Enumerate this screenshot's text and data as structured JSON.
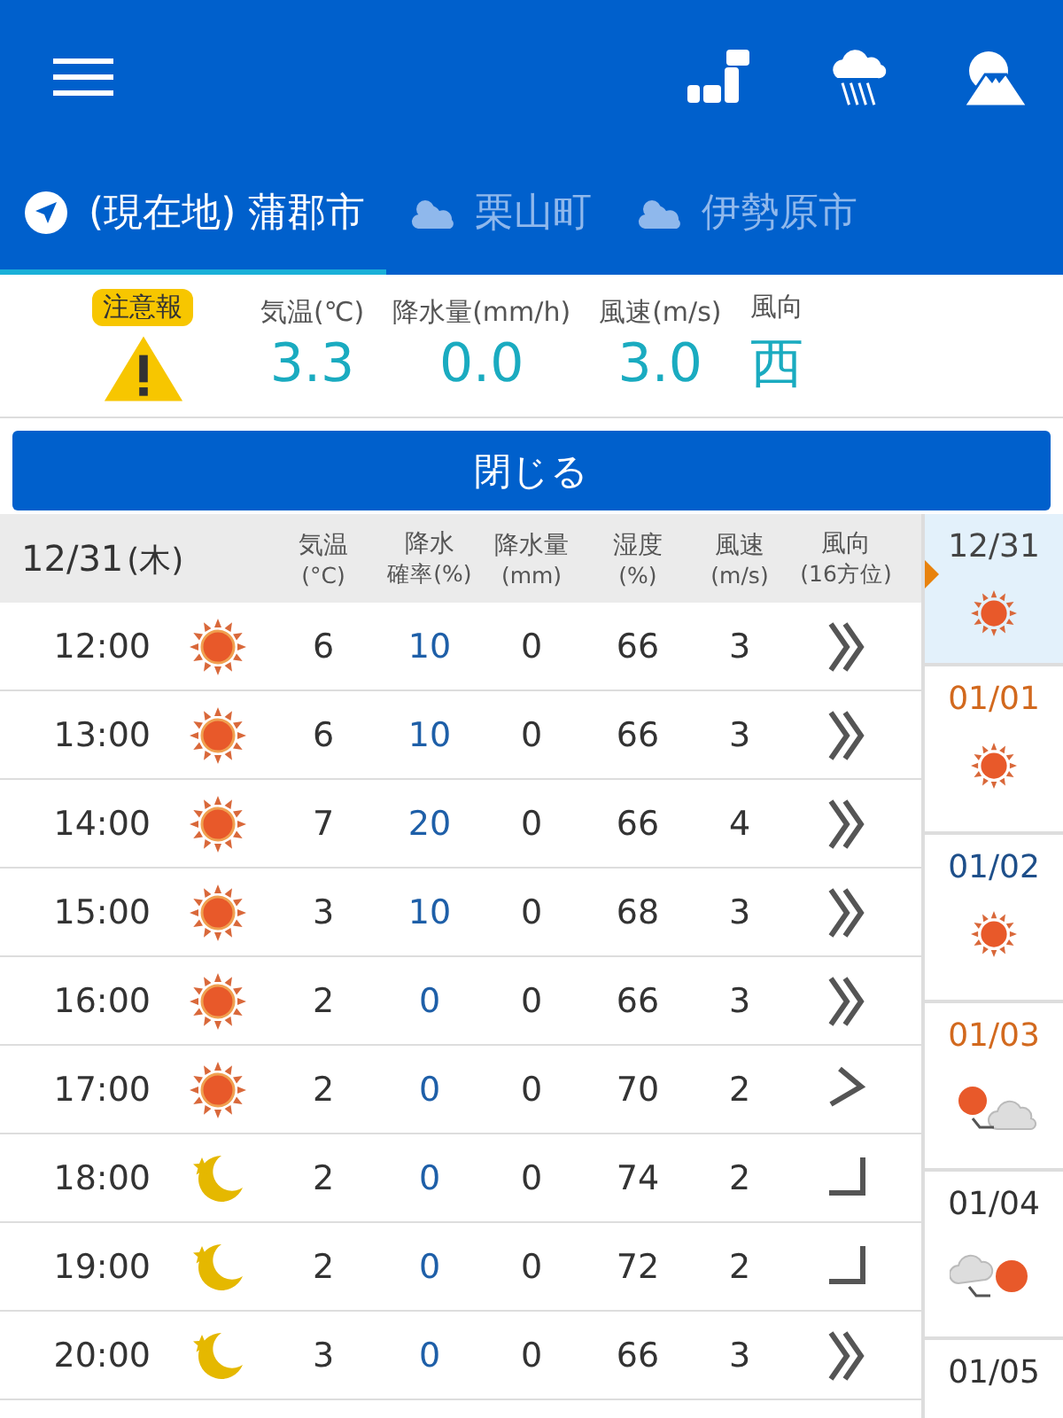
{
  "tabs": [
    {
      "label": "(現在地) 蒲郡市",
      "kind": "location",
      "selected": true
    },
    {
      "label": "栗山町",
      "kind": "partly-cloudy",
      "selected": false
    },
    {
      "label": "伊勢原市",
      "kind": "partly-cloudy",
      "selected": false
    }
  ],
  "summary": {
    "alert": "注意報",
    "items": [
      {
        "label": "気温(℃)",
        "value": "3.3"
      },
      {
        "label": "降水量(mm/h)",
        "value": "0.0"
      },
      {
        "label": "風速(m/s)",
        "value": "3.0"
      },
      {
        "label": "風向",
        "value": "西"
      }
    ]
  },
  "close_button": "閉じる",
  "table": {
    "date": "12/31",
    "weekday": "(木)",
    "columns": [
      {
        "label": "気温",
        "unit": "(°C)"
      },
      {
        "label": "降水",
        "unit": "確率(%)"
      },
      {
        "label": "降水量",
        "unit": "(mm)"
      },
      {
        "label": "湿度",
        "unit": "(%)"
      },
      {
        "label": "風速",
        "unit": "(m/s)"
      },
      {
        "label": "風向",
        "unit": "(16方位)"
      }
    ],
    "rows": [
      {
        "time": "12:00",
        "weather": {
          "kind": "sunny"
        },
        "temp": "6",
        "prob": "10",
        "rain": "0",
        "humidity": "66",
        "wind": "3",
        "wind_icon": {
          "kind": "chevrons"
        }
      },
      {
        "time": "13:00",
        "weather": {
          "kind": "sunny"
        },
        "temp": "6",
        "prob": "10",
        "rain": "0",
        "humidity": "66",
        "wind": "3",
        "wind_icon": {
          "kind": "chevrons"
        }
      },
      {
        "time": "14:00",
        "weather": {
          "kind": "sunny"
        },
        "temp": "7",
        "prob": "20",
        "rain": "0",
        "humidity": "66",
        "wind": "4",
        "wind_icon": {
          "kind": "chevrons"
        }
      },
      {
        "time": "15:00",
        "weather": {
          "kind": "sunny"
        },
        "temp": "3",
        "prob": "10",
        "rain": "0",
        "humidity": "68",
        "wind": "3",
        "wind_icon": {
          "kind": "chevrons"
        }
      },
      {
        "time": "16:00",
        "weather": {
          "kind": "sunny"
        },
        "temp": "2",
        "prob": "0",
        "rain": "0",
        "humidity": "66",
        "wind": "3",
        "wind_icon": {
          "kind": "chevrons"
        }
      },
      {
        "time": "17:00",
        "weather": {
          "kind": "sunny"
        },
        "temp": "2",
        "prob": "0",
        "rain": "0",
        "humidity": "70",
        "wind": "2",
        "wind_icon": {
          "kind": "angle-tilted"
        }
      },
      {
        "time": "18:00",
        "weather": {
          "kind": "moon"
        },
        "temp": "2",
        "prob": "0",
        "rain": "0",
        "humidity": "74",
        "wind": "2",
        "wind_icon": {
          "kind": "angle"
        }
      },
      {
        "time": "19:00",
        "weather": {
          "kind": "moon"
        },
        "temp": "2",
        "prob": "0",
        "rain": "0",
        "humidity": "72",
        "wind": "2",
        "wind_icon": {
          "kind": "angle"
        }
      },
      {
        "time": "20:00",
        "weather": {
          "kind": "moon"
        },
        "temp": "3",
        "prob": "0",
        "rain": "0",
        "humidity": "66",
        "wind": "3",
        "wind_icon": {
          "kind": "chevrons"
        }
      }
    ]
  },
  "days": [
    {
      "date": "12/31",
      "color": "#444444",
      "weather": {
        "kind": "sunny"
      },
      "selected": true
    },
    {
      "date": "01/01",
      "color": "#d2691e",
      "weather": {
        "kind": "sunny"
      },
      "selected": false
    },
    {
      "date": "01/02",
      "color": "#1e4f8a",
      "weather": {
        "kind": "sunny"
      },
      "selected": false
    },
    {
      "date": "01/03",
      "color": "#d2691e",
      "weather": {
        "kind": "sunny-to-cloudy"
      },
      "selected": false
    },
    {
      "date": "01/04",
      "color": "#333333",
      "weather": {
        "kind": "cloudy-to-sunny"
      },
      "selected": false
    },
    {
      "date": "01/05",
      "color": "#333333",
      "selected": false
    }
  ]
}
